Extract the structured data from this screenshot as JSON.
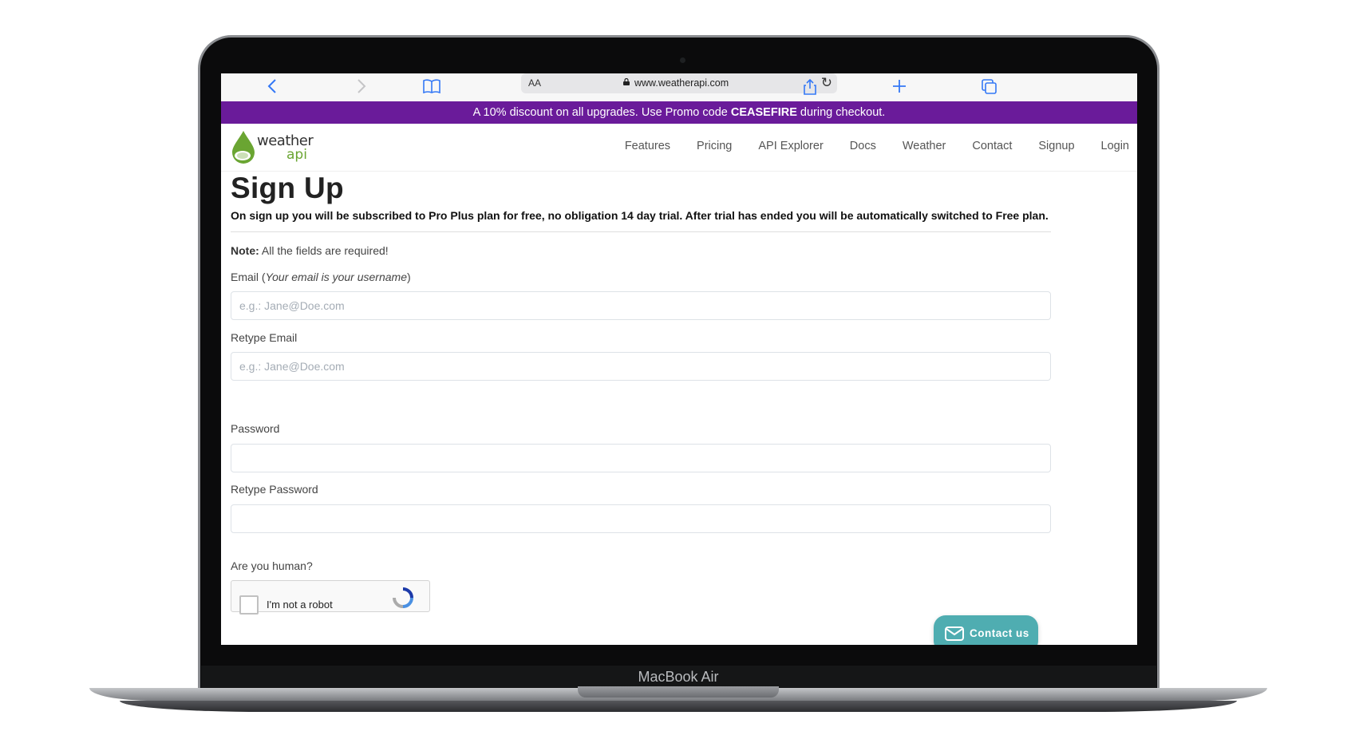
{
  "device": {
    "label": "MacBook Air"
  },
  "browser": {
    "reader_label": "AA",
    "url": "www.weatherapi.com"
  },
  "promo": {
    "text_before": "A 10% discount on all upgrades. Use Promo code ",
    "code": "CEASEFIRE",
    "text_after": " during checkout.",
    "background": "#6a1b9a"
  },
  "site": {
    "logo_word_top": "weather",
    "logo_word_bottom": "api",
    "nav": [
      "Features",
      "Pricing",
      "API Explorer",
      "Docs",
      "Weather",
      "Contact",
      "Signup",
      "Login"
    ]
  },
  "form": {
    "title": "Sign Up",
    "intro": "On sign up you will be subscribed to Pro Plus plan for free, no obligation 14 day trial. After trial has ended you will be automatically switched to Free plan.",
    "note_label": "Note:",
    "note_text": " All the fields are required!",
    "email_label": "Email (",
    "email_hint": "Your email is your username",
    "email_label_close": ")",
    "email_placeholder": "e.g.: Jane@Doe.com",
    "retype_email_label": "Retype Email",
    "retype_email_placeholder": "e.g.: Jane@Doe.com",
    "password_label": "Password",
    "retype_password_label": "Retype Password",
    "human_label": "Are you human?",
    "captcha_text": "I'm not a robot"
  },
  "contact_button": {
    "label": "Contact us",
    "color": "#4fadb1"
  }
}
